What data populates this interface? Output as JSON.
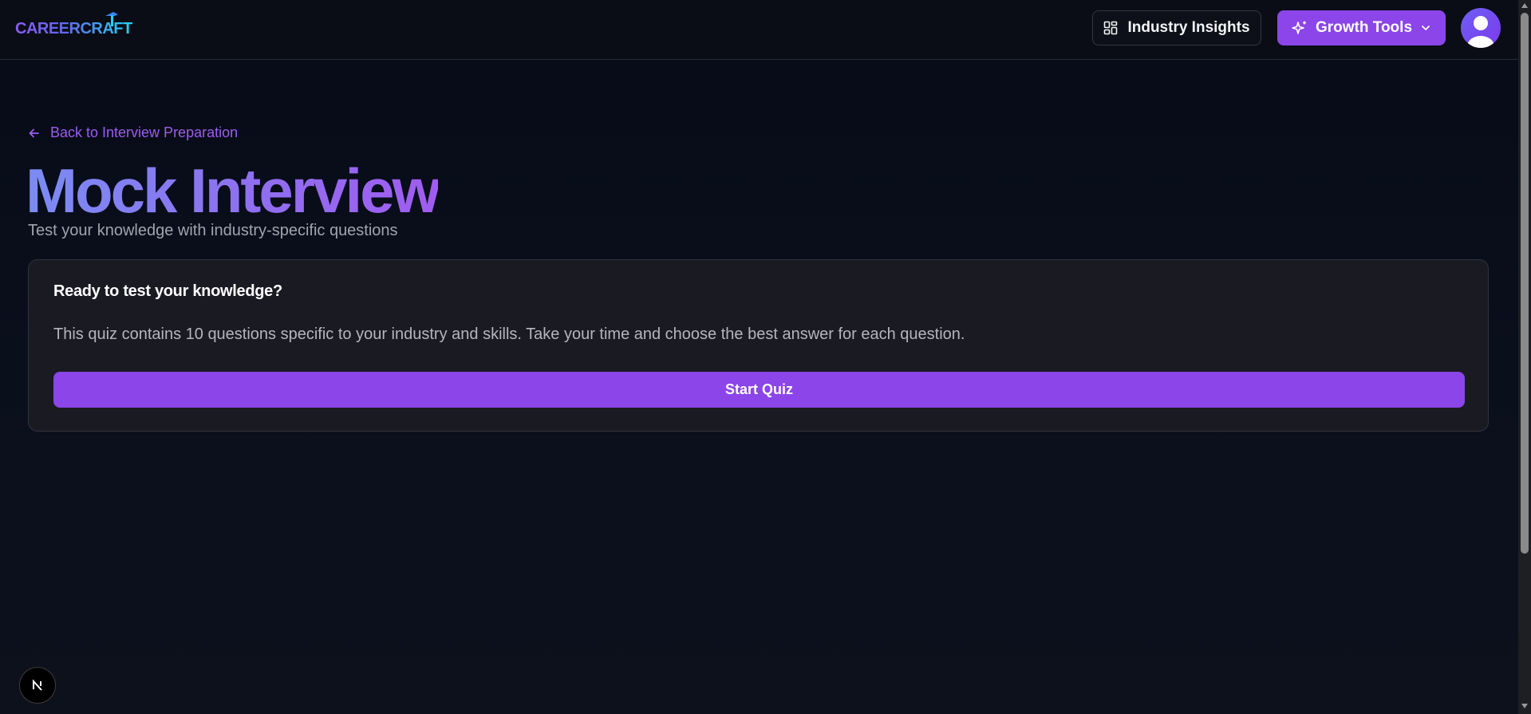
{
  "header": {
    "logo_text": "CAREERCRAFT",
    "industry_insights_label": "Industry Insights",
    "growth_tools_label": "Growth Tools"
  },
  "main": {
    "back_link_label": "Back to Interview Preparation",
    "title": "Mock Interview",
    "subtitle": "Test your knowledge with industry-specific questions",
    "card": {
      "title": "Ready to test your knowledge?",
      "description": "This quiz contains 10 questions specific to your industry and skills. Take your time and choose the best answer for each question.",
      "start_button_label": "Start Quiz"
    }
  },
  "icons": {
    "industry_insights": "dashboard-icon",
    "growth_tools": "sparkles-icon",
    "dropdown": "chevron-down-icon",
    "back": "arrow-left-icon",
    "avatar": "user-avatar-icon",
    "dev_badge": "nextjs-logo-icon"
  },
  "colors": {
    "accent": "#8b45e8",
    "link": "#9b5cf0",
    "background": "#070b17",
    "card_background": "#1a1a22"
  }
}
